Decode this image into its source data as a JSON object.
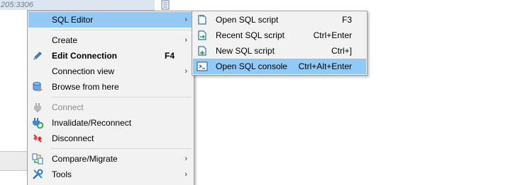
{
  "background": {
    "address_text": "205:3306"
  },
  "context_menu": {
    "items": [
      {
        "label": "SQL Editor",
        "shortcut": "",
        "submenu": true,
        "icon": "none"
      },
      {
        "label": "Create",
        "shortcut": "",
        "submenu": true,
        "icon": "none"
      },
      {
        "label": "Edit Connection",
        "shortcut": "F4",
        "submenu": false,
        "icon": "pencil-icon"
      },
      {
        "label": "Connection view",
        "shortcut": "",
        "submenu": true,
        "icon": "none"
      },
      {
        "label": "Browse from here",
        "shortcut": "",
        "submenu": false,
        "icon": "database-browse-icon"
      },
      {
        "label": "Connect",
        "shortcut": "",
        "submenu": false,
        "icon": "plug-icon",
        "disabled": true
      },
      {
        "label": "Invalidate/Reconnect",
        "shortcut": "",
        "submenu": false,
        "icon": "reconnect-icon"
      },
      {
        "label": "Disconnect",
        "shortcut": "",
        "submenu": false,
        "icon": "disconnect-icon"
      },
      {
        "label": "Compare/Migrate",
        "shortcut": "",
        "submenu": true,
        "icon": "compare-icon"
      },
      {
        "label": "Tools",
        "shortcut": "",
        "submenu": true,
        "icon": "tools-icon"
      }
    ],
    "arrow_glyph": "›"
  },
  "sql_editor_submenu": {
    "items": [
      {
        "label": "Open SQL script",
        "shortcut": "F3",
        "icon": "open-script-icon"
      },
      {
        "label": "Recent SQL script",
        "shortcut": "Ctrl+Enter",
        "icon": "recent-script-icon"
      },
      {
        "label": "New SQL script",
        "shortcut": "Ctrl+]",
        "icon": "new-script-icon"
      },
      {
        "label": "Open SQL console",
        "shortcut": "Ctrl+Alt+Enter",
        "icon": "console-icon"
      }
    ]
  },
  "colors": {
    "highlight": "#91c9f7",
    "menu_bg": "#f2f2f2",
    "disabled_text": "#8a8a8a"
  }
}
